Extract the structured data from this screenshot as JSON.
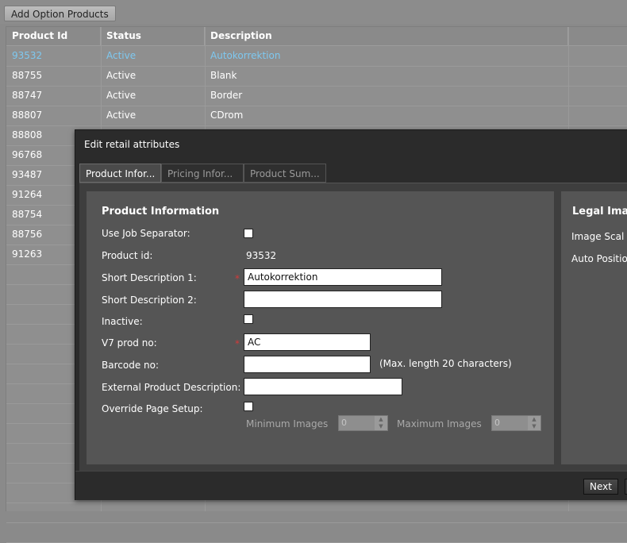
{
  "toolbar": {
    "add_label": "Add Option Products"
  },
  "table": {
    "headers": [
      "Product Id",
      "Status",
      "Description"
    ],
    "rows": [
      {
        "id": "93532",
        "status": "Active",
        "desc": "Autokorrektion"
      },
      {
        "id": "88755",
        "status": "Active",
        "desc": "Blank"
      },
      {
        "id": "88747",
        "status": "Active",
        "desc": "Border"
      },
      {
        "id": "88807",
        "status": "Active",
        "desc": "CDrom"
      },
      {
        "id": "88808",
        "status": "",
        "desc": ""
      },
      {
        "id": "96768",
        "status": "",
        "desc": ""
      },
      {
        "id": "93487",
        "status": "",
        "desc": ""
      },
      {
        "id": "91264",
        "status": "",
        "desc": ""
      },
      {
        "id": "88754",
        "status": "",
        "desc": ""
      },
      {
        "id": "88756",
        "status": "",
        "desc": ""
      },
      {
        "id": "91263",
        "status": "",
        "desc": ""
      }
    ]
  },
  "dialog": {
    "title": "Edit retail attributes",
    "tabs": [
      "Product Infor...",
      "Pricing Infor...",
      "Product Sum..."
    ],
    "section_title": "Product Information",
    "labels": {
      "job_separator": "Use Job Separator:",
      "product_id": "Product id:",
      "short_desc_1": "Short Description 1:",
      "short_desc_2": "Short Description 2:",
      "inactive": "Inactive:",
      "v7_prod": "V7 prod no:",
      "barcode": "Barcode no:",
      "external_desc": "External Product Description:",
      "override": "Override Page Setup:",
      "min_images": "Minimum Images",
      "max_images": "Maximum Images"
    },
    "values": {
      "product_id": "93532",
      "short_desc_1": "Autokorrektion",
      "short_desc_2": "",
      "v7_prod": "AC",
      "barcode": "",
      "external_desc": "",
      "min_images": "0",
      "max_images": "0"
    },
    "barcode_hint": "(Max. length 20 characters)",
    "required_mark": "*",
    "right_panel": {
      "title": "Legal Ima",
      "image_scale": "Image Scal",
      "auto_position": "Auto Positio"
    },
    "next_label": "Next"
  }
}
